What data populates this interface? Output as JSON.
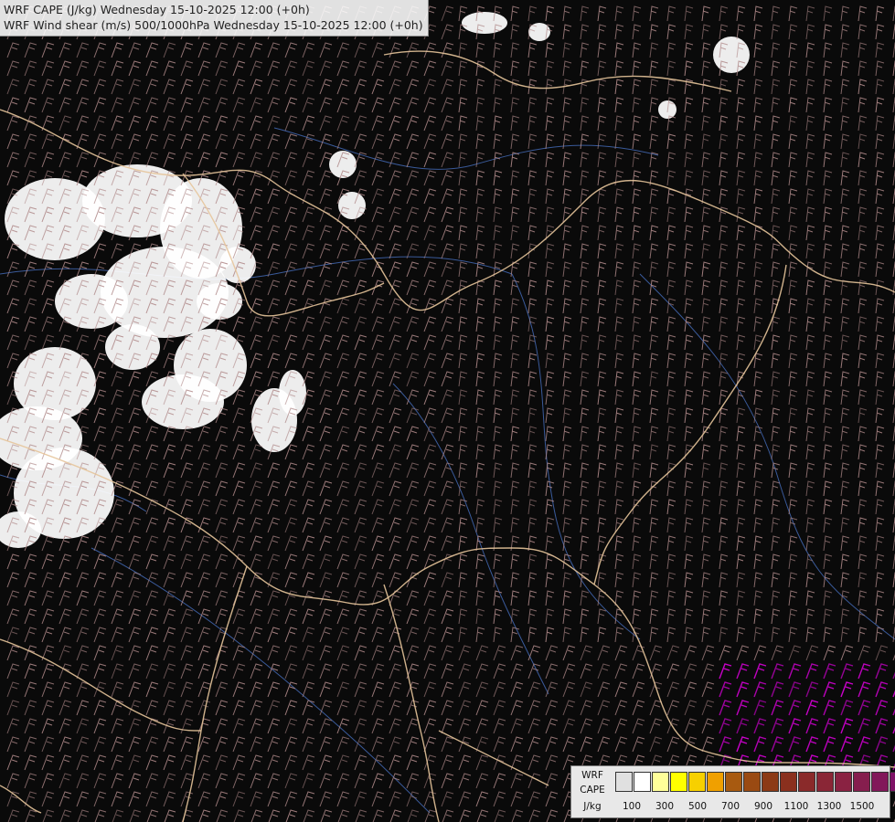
{
  "titles": {
    "line1": "WRF CAPE (J/kg) Wednesday 15-10-2025 12:00 (+0h)",
    "line2": "WRF Wind shear (m/s) 500/1000hPa Wednesday 15-10-2025 12:00 (+0h)"
  },
  "legend": {
    "label_line1": "WRF",
    "label_line2": "CAPE",
    "label_line3": "J/kg",
    "colors": [
      "#e0e0e0",
      "#ffffff",
      "#ffff99",
      "#ffff00",
      "#f7d000",
      "#f0a000",
      "#a85a10",
      "#9a4a12",
      "#8c3a16",
      "#8a301e",
      "#8a2a2a",
      "#8a2636",
      "#8a2242",
      "#861e4e",
      "#82185a",
      "#7e1266",
      "#7a0c72"
    ],
    "tick_labels": [
      "100",
      "300",
      "500",
      "700",
      "900",
      "1100",
      "1300",
      "1500"
    ]
  },
  "colors": {
    "barb_main": "#b08a8a",
    "barb_strong": "#c060c0",
    "barb_extreme": "#e000e0",
    "cape_low": "#ffffff",
    "border": "#e6c49a",
    "river": "#3a5a9a",
    "background": "#0a0a0a"
  }
}
